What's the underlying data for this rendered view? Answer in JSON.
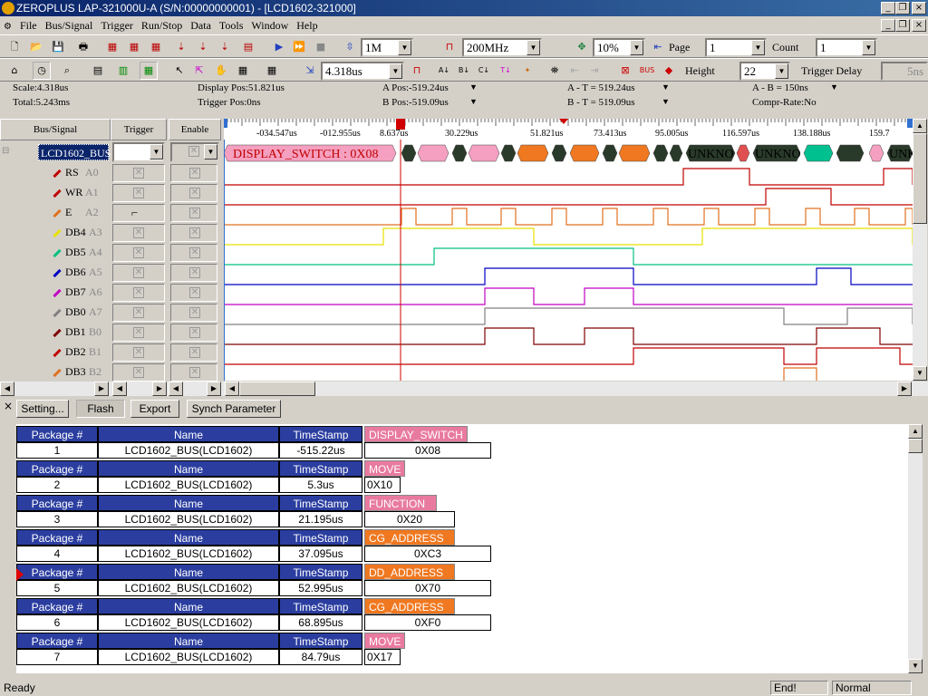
{
  "window": {
    "title": "ZEROPLUS LAP-321000U-A (S/N:00000000001) - [LCD1602-321000]"
  },
  "menu": [
    "File",
    "Bus/Signal",
    "Trigger",
    "Run/Stop",
    "Data",
    "Tools",
    "Window",
    "Help"
  ],
  "toolbar1": {
    "samples": "1M",
    "freq": "200MHz",
    "zoom": "10%",
    "page_label": "Page",
    "page": "1",
    "count_label": "Count",
    "count": "1"
  },
  "toolbar2": {
    "scale_value": "4.318us",
    "height_label": "Height",
    "height": "22",
    "trigger_delay_label": "Trigger Delay",
    "trigger_delay": "5ns"
  },
  "info": {
    "scale": "Scale:4.318us",
    "total": "Total:5.243ms",
    "display_pos": "Display Pos:51.821us",
    "trigger_pos": "Trigger Pos:0ns",
    "a_pos": "A Pos:-519.24us",
    "b_pos": "B Pos:-519.09us",
    "a_t": "A - T = 519.24us",
    "b_t": "B - T = 519.09us",
    "a_b": "A - B = 150ns",
    "compr": "Compr-Rate:No"
  },
  "columns": {
    "bus_signal": "Bus/Signal",
    "trigger": "Trigger",
    "enable": "Enable"
  },
  "timeline": [
    "-034.547us",
    "-012.955us",
    "8.637us",
    "30.229us",
    "51.821us",
    "73.413us",
    "95.005us",
    "116.597us",
    "138.188us",
    "159.7"
  ],
  "bus": {
    "name": "LCD1602_BUS",
    "first_label": "DISPLAY_SWITCH : 0X08",
    "unknown": "UNKNO",
    "unknown2": "UNKNO",
    "unknown3": "UNK"
  },
  "signals": [
    {
      "name": "RS",
      "pin": "A0",
      "color": "#c00000"
    },
    {
      "name": "WR",
      "pin": "A1",
      "color": "#c00000"
    },
    {
      "name": "E",
      "pin": "A2",
      "color": "#e07020"
    },
    {
      "name": "DB4",
      "pin": "A3",
      "color": "#e8e000"
    },
    {
      "name": "DB5",
      "pin": "A4",
      "color": "#00c080"
    },
    {
      "name": "DB6",
      "pin": "A5",
      "color": "#0000c0"
    },
    {
      "name": "DB7",
      "pin": "A6",
      "color": "#c000c0"
    },
    {
      "name": "DB0",
      "pin": "A7",
      "color": "#808080"
    },
    {
      "name": "DB1",
      "pin": "B0",
      "color": "#800000"
    },
    {
      "name": "DB2",
      "pin": "B1",
      "color": "#c00000"
    },
    {
      "name": "DB3",
      "pin": "B2",
      "color": "#e07020"
    }
  ],
  "buttons": {
    "setting": "Setting...",
    "flash": "Flash",
    "export": "Export",
    "synch": "Synch Parameter"
  },
  "packets_header": {
    "num": "Package #",
    "name": "Name",
    "ts": "TimeStamp"
  },
  "packets": [
    {
      "num": "1",
      "name": "LCD1602_BUS(LCD1602)",
      "ts": "-515.22us",
      "tag": "DISPLAY_SWITCH",
      "value": "0X08",
      "color": "#e87aa0"
    },
    {
      "num": "2",
      "name": "LCD1602_BUS(LCD1602)",
      "ts": "5.3us",
      "tag": "MOVE",
      "value": "0X10",
      "color": "#e87aa0"
    },
    {
      "num": "3",
      "name": "LCD1602_BUS(LCD1602)",
      "ts": "21.195us",
      "tag": "FUNCTION",
      "value": "0X20",
      "color": "#e87aa0"
    },
    {
      "num": "4",
      "name": "LCD1602_BUS(LCD1602)",
      "ts": "37.095us",
      "tag": "CG_ADDRESS",
      "value": "0XC3",
      "color": "#f07820"
    },
    {
      "num": "5",
      "name": "LCD1602_BUS(LCD1602)",
      "ts": "52.995us",
      "tag": "DD_ADDRESS",
      "value": "0X70",
      "color": "#f07820"
    },
    {
      "num": "6",
      "name": "LCD1602_BUS(LCD1602)",
      "ts": "68.895us",
      "tag": "CG_ADDRESS",
      "value": "0XF0",
      "color": "#f07820"
    },
    {
      "num": "7",
      "name": "LCD1602_BUS(LCD1602)",
      "ts": "84.79us",
      "tag": "MOVE",
      "value": "0X17",
      "color": "#e87aa0"
    }
  ],
  "status": {
    "ready": "Ready",
    "end": "End!",
    "mode": "Normal"
  }
}
